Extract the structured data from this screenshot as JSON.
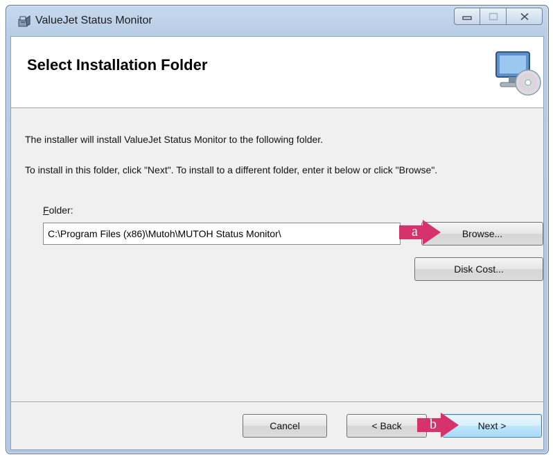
{
  "window": {
    "title": "ValueJet Status Monitor",
    "caption_buttons": {
      "minimize": "▭",
      "maximize": "☐",
      "close": "☒"
    }
  },
  "banner": {
    "title": "Select Installation Folder",
    "icon": "computer-disc-icon"
  },
  "body": {
    "line1": "The installer will install ValueJet Status Monitor to the following folder.",
    "line2": "To install in this folder, click \"Next\". To install to a different folder, enter it below or click \"Browse\"."
  },
  "folder": {
    "label": "Folder:",
    "label_mnemonic": "F",
    "label_rest": "older:",
    "value": "C:\\Program Files (x86)\\Mutoh\\MUTOH Status Monitor\\"
  },
  "buttons": {
    "browse": "Browse...",
    "disk_cost": "Disk Cost...",
    "cancel": "Cancel",
    "back": "< Back",
    "next": "Next >"
  },
  "annotations": {
    "a": "a",
    "b": "b",
    "color": "#d6336c"
  }
}
